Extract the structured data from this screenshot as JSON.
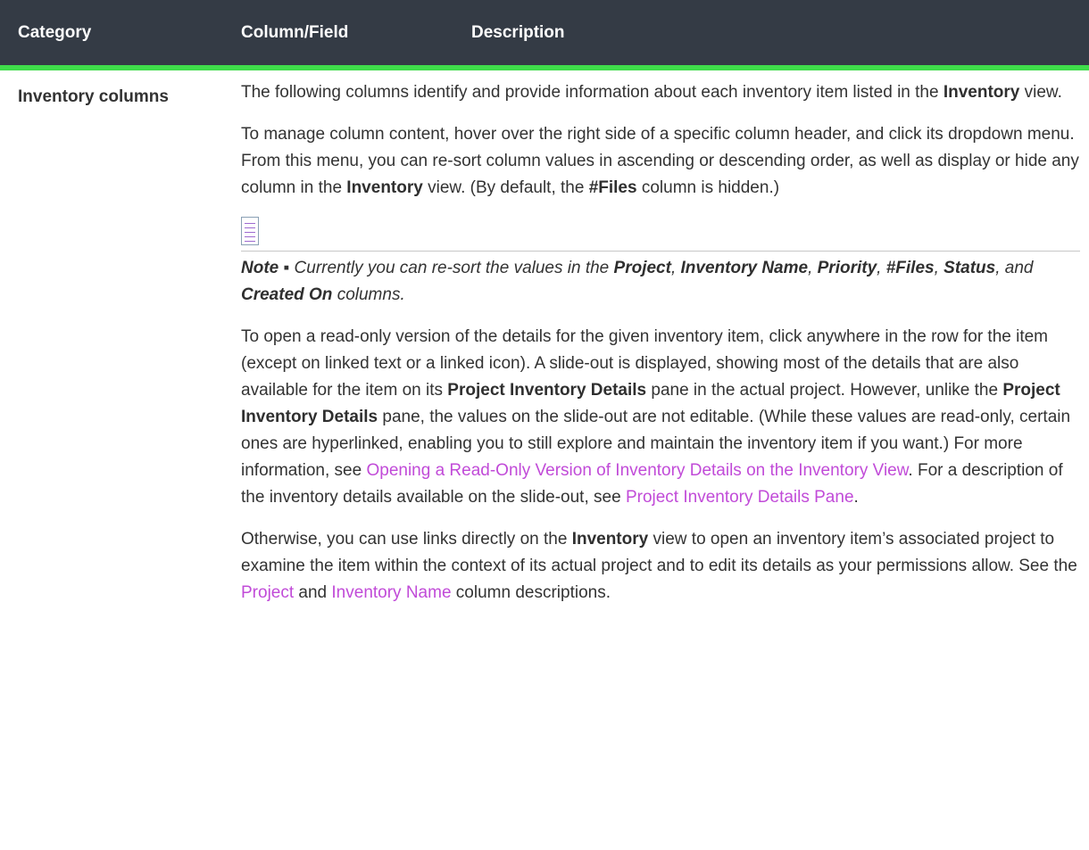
{
  "header": {
    "category": "Category",
    "column_field": "Column/Field",
    "description": "Description"
  },
  "row": {
    "category": "Inventory columns"
  },
  "p1": {
    "a": "The following columns identify and provide information about each inventory item listed in the ",
    "b1": "Inventory",
    "c": " view."
  },
  "p2": {
    "a": "To manage column content, hover over the right side of a specific column header, and click its dropdown menu. From this menu, you can re-sort column values in ascending or descending order, as well as display or hide any column in the ",
    "b1": "Inventory",
    "c": " view. (By default, the ",
    "b2": "#Files",
    "d": " column is hidden.)"
  },
  "note": {
    "icon": "note-icon",
    "label": "Note",
    "bullet": " ▪ Currently you can re-sort the values in the ",
    "f1": "Project",
    "s1": ", ",
    "f2": "Inventory Name",
    "s2": ", ",
    "f3": "Priority",
    "s3": ", ",
    "f4": "#Files",
    "s4": ", ",
    "f5": "Status",
    "s5": ", and ",
    "f6": "Created On",
    "end": " columns."
  },
  "p3": {
    "a": "To open a read-only version of the details for the given inventory item, click anywhere in the row for the item (except on linked text or a linked icon). A slide-out is displayed, showing most of the details that are also available for the item on its ",
    "b1": "Project Inventory Details",
    "c": " pane in the actual project. However, unlike the ",
    "b2": "Project Inventory Details",
    "d": " pane, the values on the slide-out are not editable. (While these values are read-only, certain ones are hyperlinked, enabling you to still explore and maintain the inventory item if you want.) For more information, see ",
    "link1": "Opening a Read-Only Version of Inventory Details on the Inventory View",
    "e": ". For a description of the inventory details available on the slide-out, see ",
    "link2": "Project Inventory Details Pane",
    "f": "."
  },
  "p4": {
    "a": "Otherwise, you can use links directly on the ",
    "b1": "Inventory",
    "c": " view to open an inventory item’s associated project to examine the item within the context of its actual project and to edit its details as your permissions allow. See the ",
    "link1": "Project",
    "d": " and ",
    "link2": "Inventory Name",
    "e": " column descriptions."
  },
  "colors": {
    "header_bg": "#343b45",
    "header_underline": "#3fdc4a",
    "link": "#c14bd8"
  }
}
